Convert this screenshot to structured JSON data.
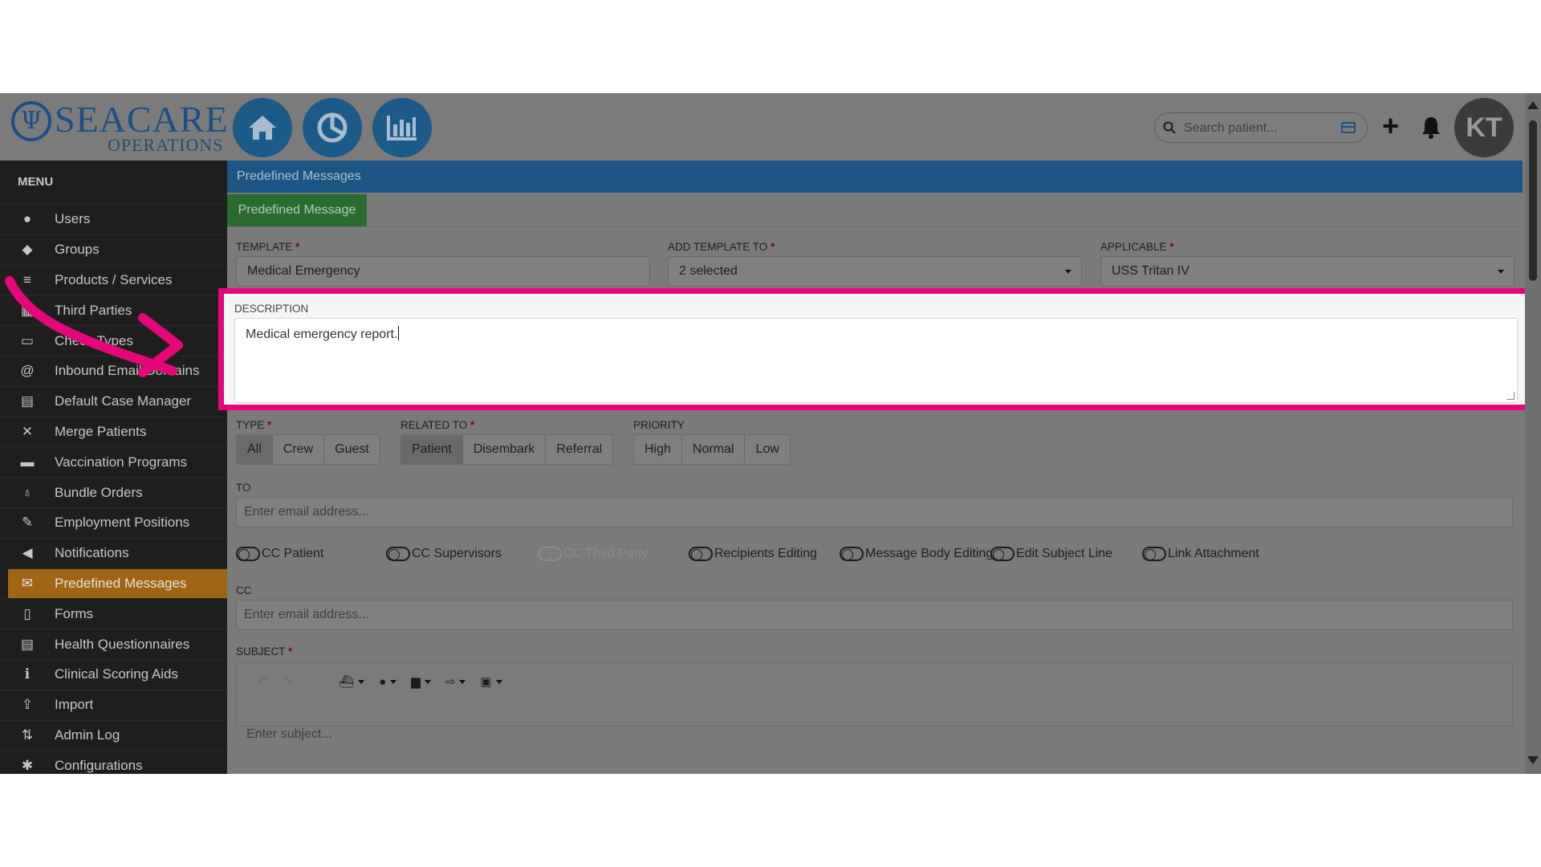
{
  "brand": {
    "name": "SEACARE",
    "sub": "OPERATIONS",
    "emblem": "Ψ"
  },
  "header": {
    "search_placeholder": "Search patient...",
    "avatar_initials": "KT",
    "icons": [
      "home-icon",
      "pie-chart-icon",
      "bar-chart-icon",
      "search-icon",
      "card-icon",
      "plus-icon",
      "bell-icon"
    ]
  },
  "sidebar": {
    "title": "MENU",
    "items": [
      {
        "label": "Users",
        "icon": "user-icon"
      },
      {
        "label": "Groups",
        "icon": "users-icon"
      },
      {
        "label": "Products / Services",
        "icon": "list-icon"
      },
      {
        "label": "Third Parties",
        "icon": "building-icon"
      },
      {
        "label": "Check Types",
        "icon": "money-icon"
      },
      {
        "label": "Inbound Email Domains",
        "icon": "at-icon"
      },
      {
        "label": "Default Case Manager",
        "icon": "id-card-icon"
      },
      {
        "label": "Merge Patients",
        "icon": "merge-icon"
      },
      {
        "label": "Vaccination Programs",
        "icon": "briefcase-icon"
      },
      {
        "label": "Bundle Orders",
        "icon": "stethoscope-icon"
      },
      {
        "label": "Employment Positions",
        "icon": "wrench-icon"
      },
      {
        "label": "Notifications",
        "icon": "megaphone-icon"
      },
      {
        "label": "Predefined Messages",
        "icon": "envelope-icon",
        "active": true
      },
      {
        "label": "Forms",
        "icon": "file-icon"
      },
      {
        "label": "Health Questionnaires",
        "icon": "questionnaire-icon"
      },
      {
        "label": "Clinical Scoring Aids",
        "icon": "info-icon"
      },
      {
        "label": "Import",
        "icon": "upload-icon"
      },
      {
        "label": "Admin Log",
        "icon": "sort-icon"
      },
      {
        "label": "Configurations",
        "icon": "cogs-icon"
      }
    ]
  },
  "page": {
    "title": "Predefined Messages",
    "tab": "Predefined Message",
    "template_label": "TEMPLATE",
    "template_value": "Medical Emergency",
    "add_template_label": "ADD TEMPLATE TO",
    "add_template_value": "2 selected",
    "applicable_label": "APPLICABLE",
    "applicable_value": "USS Tritan IV",
    "description_label": "DESCRIPTION",
    "description_value": "Medical emergency report.",
    "type_label": "TYPE",
    "type_options": [
      "All",
      "Crew",
      "Guest"
    ],
    "related_label": "RELATED TO",
    "related_options": [
      "Patient",
      "Disembark",
      "Referral"
    ],
    "priority_label": "PRIORITY",
    "priority_options": [
      "High",
      "Normal",
      "Low"
    ],
    "to_label": "TO",
    "to_placeholder": "Enter email address...",
    "toggles": [
      "CC Patient",
      "CC Supervisors",
      "CC Third Party",
      "Recipients Editing",
      "Message Body Editing",
      "Edit Subject Line",
      "Link Attachment"
    ],
    "cc_label": "CC",
    "cc_placeholder": "Enter email address...",
    "subject_label": "SUBJECT",
    "subject_placeholder": "Enter subject...",
    "required_mark": "*"
  },
  "colors": {
    "highlight": "#e5077a",
    "title_bar": "#1d5685",
    "tab": "#2a6b30",
    "active_nav": "#a06514",
    "brand": "#1d4f86"
  }
}
